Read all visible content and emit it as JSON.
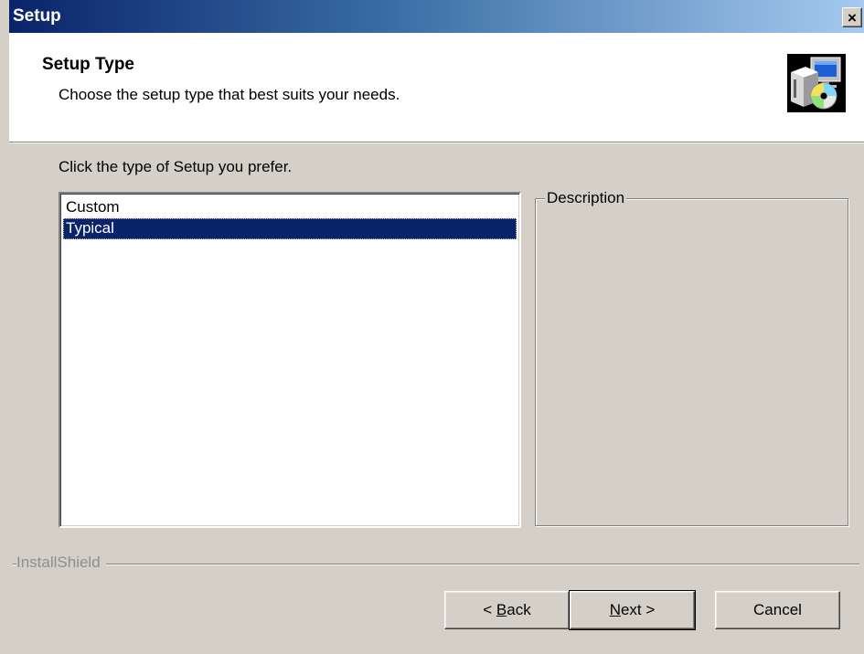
{
  "window": {
    "title": "Setup",
    "close_glyph": "×"
  },
  "header": {
    "title": "Setup Type",
    "subtitle": "Choose the setup type that best suits your needs.",
    "icon": "computer-setup-cd-icon"
  },
  "main": {
    "prompt": "Click the type of Setup you prefer.",
    "setup_types": [
      {
        "label": "Custom",
        "selected": false
      },
      {
        "label": "Typical",
        "selected": true
      }
    ],
    "description_label": "Description"
  },
  "footer": {
    "brand": "InstallShield",
    "back": {
      "mnemonic": "B",
      "before": "< ",
      "after": "ack"
    },
    "next": {
      "mnemonic": "N",
      "after": "ext >"
    },
    "cancel_label": "Cancel"
  },
  "colors": {
    "face": "#d4d0c8",
    "selection": "#0a246a",
    "title_gradient_start": "#0a246a",
    "title_gradient_end": "#a6caf0"
  }
}
